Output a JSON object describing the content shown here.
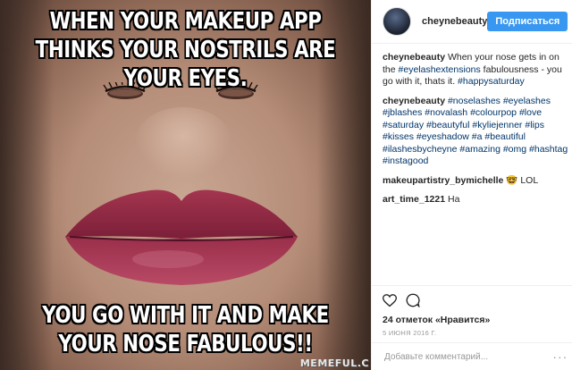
{
  "photo": {
    "top_text": "WHEN YOUR MAKEUP APP THINKS YOUR NOSTRILS ARE YOUR EYES.",
    "bottom_text": "YOU GO WITH IT AND MAKE YOUR NOSE FABULOUS!!",
    "watermark": "MEMEFUL.C"
  },
  "header": {
    "username": "cheynebeauty",
    "follow_label": "Подписаться"
  },
  "comments": [
    {
      "user": "cheynebeauty",
      "parts": [
        {
          "text": " When your nose gets in on the ",
          "tag": false
        },
        {
          "text": "#eyelashextensions",
          "tag": true
        },
        {
          "text": " fabulousness - you go with it, thats it. ",
          "tag": false
        },
        {
          "text": "#happysaturday",
          "tag": true
        }
      ]
    },
    {
      "user": "cheynebeauty",
      "parts": [
        {
          "text": " #noselashes #eyelashes #jblashes #novalash #colourpop #love #saturday #beautyful #kyliejenner #lips #kisses #eyeshadow #a #beautiful #ilashesbycheyne #amazing #omg #hashtag #instagood",
          "tag": true
        }
      ]
    },
    {
      "user": "makeupartistry_bymichelle",
      "parts": [
        {
          "text": " 🤓 LOL",
          "tag": false
        }
      ]
    },
    {
      "user": "art_time_1221",
      "parts": [
        {
          "text": " На",
          "tag": false
        }
      ]
    }
  ],
  "actions": {
    "like_icon": "heart-icon",
    "comment_icon": "comment-icon"
  },
  "likes_text": "24 отметок «Нравится»",
  "date_text": "5 ИЮНЯ 2016 Г.",
  "add_comment": {
    "placeholder": "Добавьте комментарий...",
    "more_label": "···"
  },
  "colors": {
    "follow_button": "#3897f0",
    "hashtag": "#003569"
  }
}
